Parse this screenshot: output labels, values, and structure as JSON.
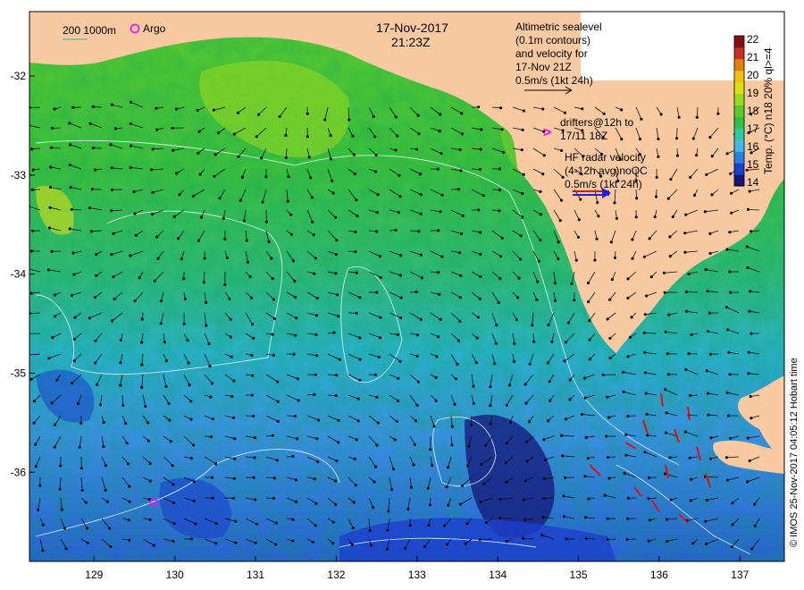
{
  "map": {
    "date": "17-Nov-2017",
    "time": "21:23Z",
    "lon_ticks": [
      "129",
      "130",
      "131",
      "132",
      "133",
      "134",
      "135",
      "136",
      "137"
    ],
    "lat_ticks": [
      "-32",
      "-33",
      "-34",
      "-35",
      "-36"
    ],
    "lon_values": [
      129,
      130,
      131,
      132,
      133,
      134,
      135,
      136,
      137
    ],
    "lat_values": [
      -32,
      -33,
      -34,
      -35,
      -36
    ],
    "lon_range": [
      128.2,
      137.55
    ],
    "lat_range": [
      -36.9,
      -31.35
    ],
    "land_color": "#f9c9a2",
    "argo_marker_color": "#ff00ff",
    "radar_arrow_color": "#2a1bd6",
    "hf_vector_color": "#e01010"
  },
  "legend": {
    "bathy_label": "200  1000m",
    "argo_label": "Argo",
    "altimetry_lines": [
      "Altimetric sealevel",
      "(0.1m contours)",
      "and velocity for",
      "17-Nov 21Z",
      "0.5m/s (1kt 24h)"
    ],
    "drifters_lines": [
      "drifters@12h to",
      "17/11 18Z"
    ],
    "drifter_symbol": ">",
    "hf_lines": [
      "HF radar velocity",
      "(4-12h avg)noQC",
      "0.5m/s (1kt 24h)"
    ]
  },
  "colorbar": {
    "ticks": [
      "22",
      "21",
      "20",
      "19",
      "18",
      "17",
      "16",
      "15",
      "14"
    ],
    "title": "Temp. (°C) n18 20% ql>=4",
    "colors": [
      "#16157a",
      "#1b40cc",
      "#2a80e0",
      "#45b8e8",
      "#2fc8a0",
      "#30c050",
      "#5cc830",
      "#9ad820",
      "#d8e018",
      "#f0c010",
      "#e08010",
      "#c83020",
      "#801010"
    ]
  },
  "credit": "© IMOS 25-Nov-2017 04:05:12 Hobart time"
}
